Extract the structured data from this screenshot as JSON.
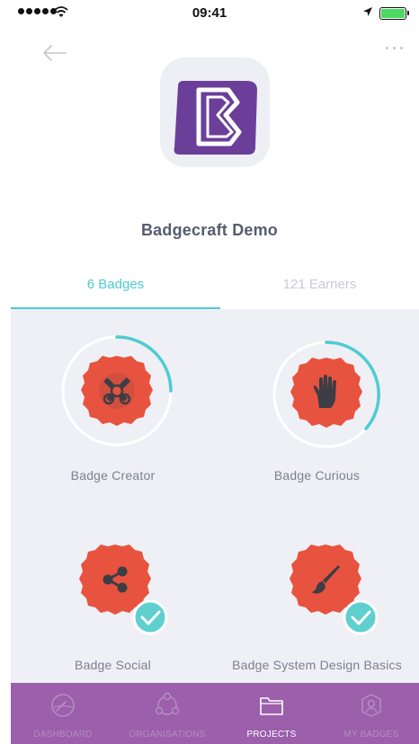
{
  "status_bar": {
    "time": "09:41"
  },
  "project": {
    "title": "Badgecraft Demo"
  },
  "tabs": {
    "badges": "6 Badges",
    "earners": "121 Earners"
  },
  "badges": [
    {
      "label": "Badge Creator",
      "icon": "pencil-ruler-icon",
      "progress": 0.25,
      "completed": false
    },
    {
      "label": "Badge Curious",
      "icon": "hand-icon",
      "progress": 0.4,
      "completed": false
    },
    {
      "label": "Badge Social",
      "icon": "share-icon",
      "completed": true
    },
    {
      "label": "Badge System Design Basics",
      "icon": "paintbrush-icon",
      "completed": true
    }
  ],
  "bottom_nav": [
    {
      "label": "DASHBOARD",
      "icon": "gauge-icon",
      "active": false
    },
    {
      "label": "ORGANISATIONS",
      "icon": "organisations-icon",
      "active": false
    },
    {
      "label": "PROJECTS",
      "icon": "folder-icon",
      "active": true
    },
    {
      "label": "MY BADGES",
      "icon": "profile-badge-icon",
      "active": false
    }
  ],
  "colors": {
    "accent": "#4fcbd3",
    "badge": "#e8533f",
    "brand": "#6b3f99",
    "nav_bg": "#9b5fab",
    "check": "#5fcfcf"
  }
}
